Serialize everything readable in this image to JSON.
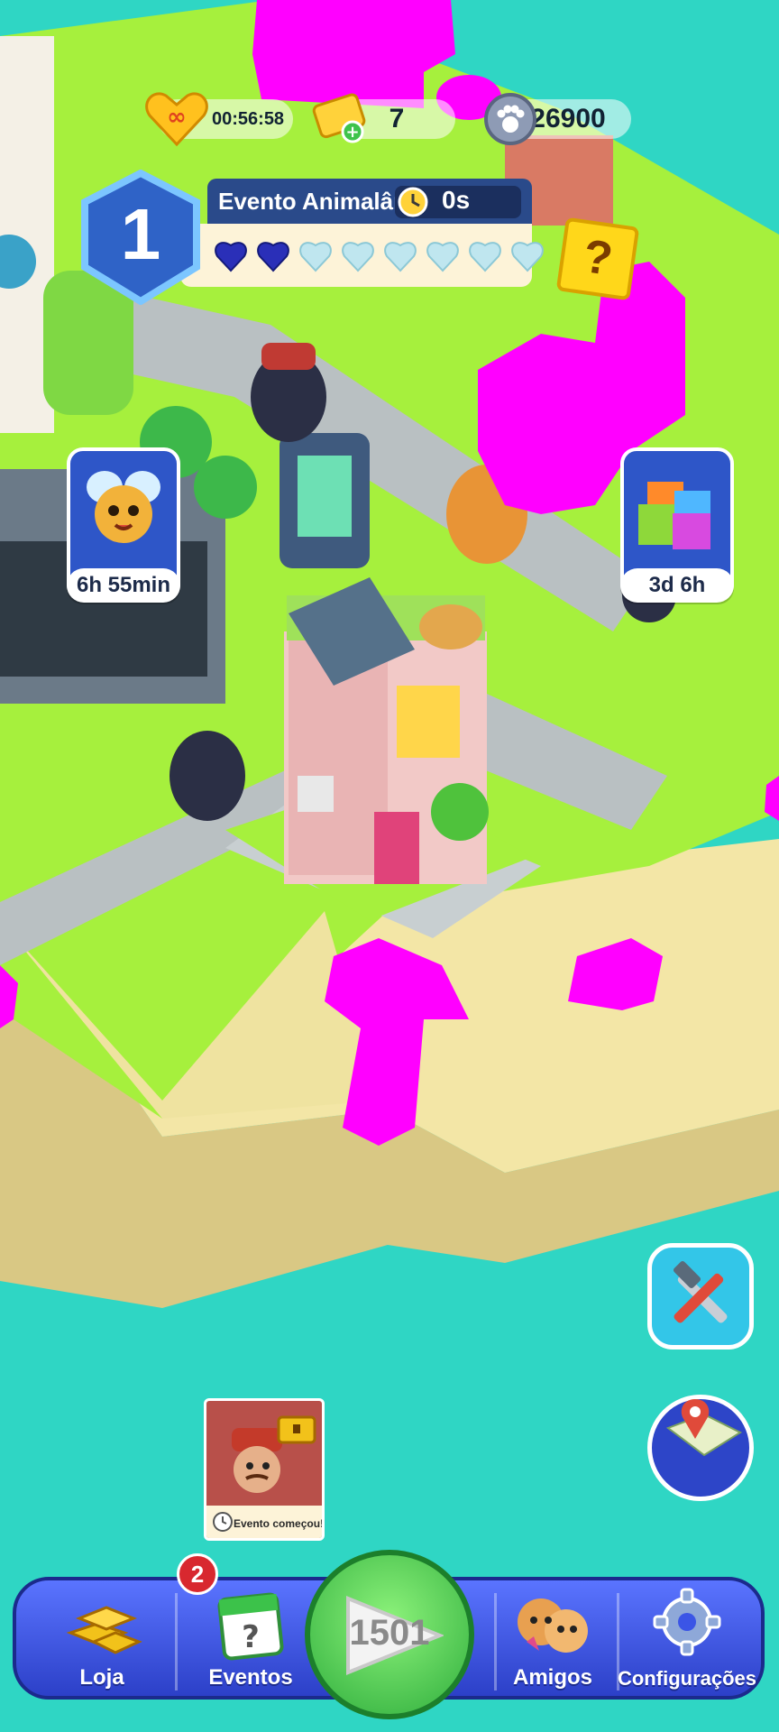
{
  "hud": {
    "lives_timer": "00:56:58",
    "tickets": "7",
    "paw_coins": "26900"
  },
  "event": {
    "level": "1",
    "name": "Evento Animalândia",
    "timer": "0s",
    "hearts_filled": 2,
    "hearts_total": 8,
    "help_symbol": "?"
  },
  "side_timers": {
    "left": "6h 55min",
    "right": "3d 6h"
  },
  "event_popup": {
    "label": "Evento começou!"
  },
  "nav": {
    "shop": "Loja",
    "events": "Eventos",
    "events_badge": "2",
    "play_level": "1501",
    "friends": "Amigos",
    "settings": "Configurações"
  },
  "colors": {
    "grass": "#a6f03d",
    "sand": "#f3e6a6",
    "water": "#2fd6c4",
    "road": "#b9c0c2",
    "magenta_mask": "#ff00ff",
    "nav_blue": "#3b55e6",
    "play_green": "#3cc24a"
  }
}
